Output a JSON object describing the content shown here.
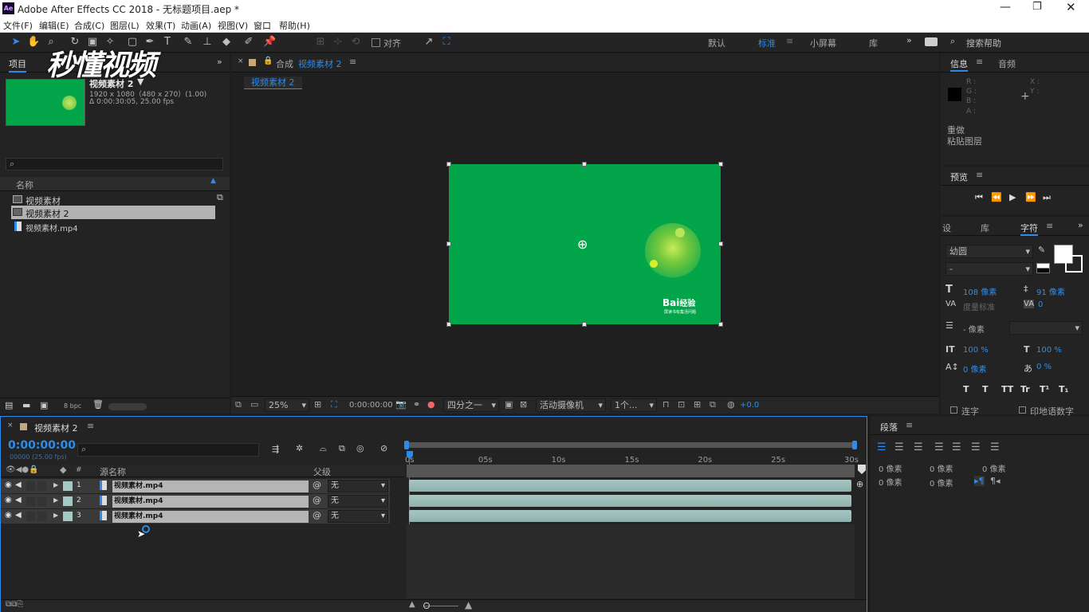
{
  "window": {
    "title": "Adobe After Effects CC 2018 - 无标题项目.aep *",
    "app_icon": "Ae"
  },
  "menu": [
    "文件(F)",
    "编辑(E)",
    "合成(C)",
    "图层(L)",
    "效果(T)",
    "动画(A)",
    "视图(V)",
    "窗口",
    "帮助(H)"
  ],
  "toolbar": {
    "snap_label": "对齐",
    "workspaces": [
      "默认",
      "标准",
      "小屏幕",
      "库"
    ],
    "active_workspace": "标准",
    "search_placeholder": "搜索帮助"
  },
  "watermark": "秒懂视频",
  "project": {
    "tab": "项目",
    "thumb_name": "视频素材 2",
    "thumb_info1": "1920 x 1080（480 x 270）(1.00)",
    "thumb_info2": "Δ 0:00:30:05, 25.00 fps",
    "col_name": "名称",
    "items": [
      "视频素材",
      "视频素材 2",
      "视频素材.mp4"
    ],
    "bpc": "8 bpc"
  },
  "comp": {
    "tab_prefix": "合成",
    "tab_name": "视频素材 2",
    "subtab": "视频素材 2",
    "zoom": "25%",
    "timecode": "0:00:00:00",
    "resolution": "四分之一",
    "camera": "活动摄像机",
    "views": "1个...",
    "exposure": "+0.0"
  },
  "baidu": {
    "logo": "Bai",
    "logo2": "经验",
    "slogan": "屏读书有集活问题"
  },
  "info": {
    "tab1": "信息",
    "tab2": "音频",
    "r": "R :",
    "g": "G :",
    "b": "B :",
    "a": "A :",
    "x": "X :",
    "y": "Y :",
    "undo": "重做",
    "paste": "粘贴图层"
  },
  "preview": {
    "tab": "预览"
  },
  "character": {
    "tab_a": "设",
    "tab_b": "库",
    "tab_c": "字符",
    "font": "幼圆",
    "style": "-",
    "size": "108 像素",
    "leading": "91 像素",
    "kerning": "度量标准",
    "tracking": "0",
    "stroke": "- 像素",
    "vscale": "100 %",
    "hscale": "100 %",
    "baseline": "0 像素",
    "tsume": "0 %",
    "styles": [
      "T",
      "T",
      "TT",
      "Tr",
      "T¹",
      "T₁"
    ],
    "opt1": "连字",
    "opt2": "印地语数字"
  },
  "paragraph": {
    "tab": "段落",
    "indent1": "0 像素",
    "indent2": "0 像素",
    "indent3": "0 像素",
    "space1": "0 像素",
    "space2": "0 像素"
  },
  "timeline": {
    "tab": "视频素材 2",
    "timecode": "0:00:00:00",
    "fps": "00000 (25.00 fps)",
    "col_source": "源名称",
    "col_parent": "父级",
    "ticks": [
      "0s",
      "05s",
      "10s",
      "15s",
      "20s",
      "25s",
      "30s"
    ],
    "layers": [
      {
        "num": "1",
        "name": "视频素材.mp4",
        "parent": "无"
      },
      {
        "num": "2",
        "name": "视频素材.mp4",
        "parent": "无"
      },
      {
        "num": "3",
        "name": "视频素材.mp4",
        "parent": "无"
      }
    ]
  },
  "colors": {
    "accent": "#2d8ceb",
    "comp_green": "#03a54a",
    "bar": "#9dbfba"
  }
}
